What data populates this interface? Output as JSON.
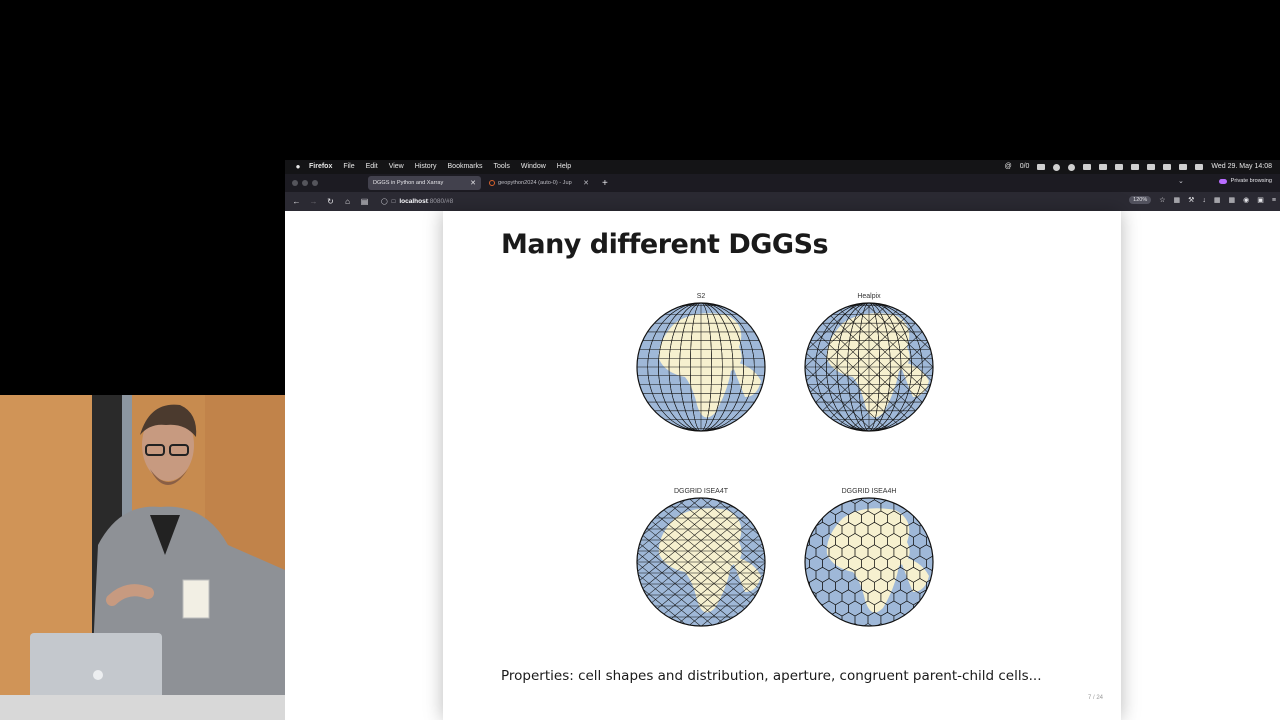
{
  "menubar": {
    "app_name": "Firefox",
    "menus": [
      "File",
      "Edit",
      "View",
      "History",
      "Bookmarks",
      "Tools",
      "Window",
      "Help"
    ],
    "counter": "0/0",
    "datetime": "Wed 29. May  14:08"
  },
  "tabs": [
    {
      "title": "DGGS in Python and Xarray",
      "active": true
    },
    {
      "title": "geopython2024 (auto-0) - Jup",
      "active": false
    }
  ],
  "private_label": "Private browsing",
  "address": {
    "host": "localhost",
    "path": ":8080/#8"
  },
  "zoom": "120%",
  "slide": {
    "title": "Many different DGGSs",
    "globes": [
      {
        "label": "S2",
        "grid": "quad"
      },
      {
        "label": "Healpix",
        "grid": "healpix"
      },
      {
        "label": "DGGRID ISEA4T",
        "grid": "tri"
      },
      {
        "label": "DGGRID ISEA4H",
        "grid": "hex"
      }
    ],
    "caption": "Properties: cell shapes and distribution, aperture, congruent parent-child cells...",
    "page_number": "7 / 24"
  },
  "colors": {
    "ocean": "#9fb8d8",
    "land": "#f6f0cf",
    "grid": "#111111"
  }
}
